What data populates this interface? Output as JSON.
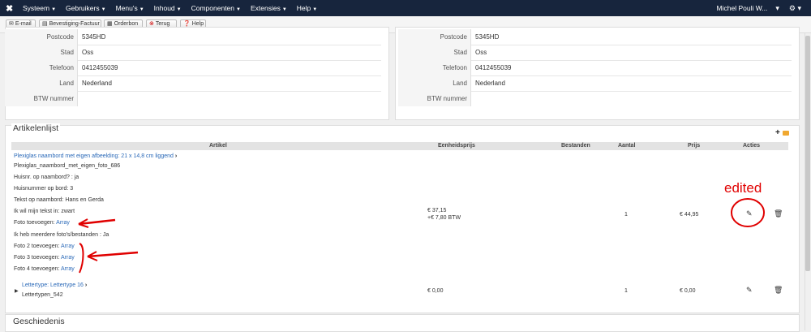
{
  "topbar": {
    "menu": [
      {
        "label": "Systeem"
      },
      {
        "label": "Gebruikers"
      },
      {
        "label": "Menu's"
      },
      {
        "label": "Inhoud"
      },
      {
        "label": "Componenten"
      },
      {
        "label": "Extensies"
      },
      {
        "label": "Help"
      }
    ],
    "user_name": "Michel Pouli W..."
  },
  "toolbar": {
    "email_label": "E-mail",
    "confirm_label": "Bevestiging-Factuur",
    "order_label": "Orderbon",
    "back_label": "Terug",
    "help_label": "Help"
  },
  "billing_address": {
    "postcode_label": "Postcode",
    "postcode": "5345HD",
    "city_label": "Stad",
    "city": "Oss",
    "phone_label": "Telefoon",
    "phone": "0412455039",
    "country_label": "Land",
    "country": "Nederland",
    "vat_label": "BTW nummer",
    "vat": ""
  },
  "shipping_address": {
    "postcode_label": "Postcode",
    "postcode": "5345HD",
    "city_label": "Stad",
    "city": "Oss",
    "phone_label": "Telefoon",
    "phone": "0412455039",
    "country_label": "Land",
    "country": "Nederland",
    "vat_label": "BTW nummer",
    "vat": ""
  },
  "articles": {
    "title": "Artikelenlijst",
    "columns": {
      "article": "Artikel",
      "unit_price": "Eenheidsprijs",
      "files": "Bestanden",
      "quantity": "Aantal",
      "price": "Prijs",
      "actions": "Acties"
    },
    "item1": {
      "name": "Plexiglas naambord met eigen afbeelding: 21 x 14,8 cm liggend",
      "sku": "Plexiglas_naambord_met_eigen_foto_686",
      "attr1": "Huisnr. op naambord? : ja",
      "attr2": "Huisnummer op bord: 3",
      "attr3": "Tekst op naambord: Hans en Gerda",
      "attr4": "Ik wil mijn tekst in: zwart",
      "attr5_label": "Foto toevoegen:",
      "attr5_value": "Array",
      "attr6": "Ik heb meerdere foto's/bestanden : Ja",
      "attr7_label": "Foto 2 toevoegen:",
      "attr7_value": "Array",
      "attr8_label": "Foto 3 toevoegen:",
      "attr8_value": "Array",
      "attr9_label": "Foto 4 toevoegen:",
      "attr9_value": "Array",
      "unit_price": "€ 37,15",
      "tax": "+€ 7,80 BTW",
      "quantity": "1",
      "price": "€ 44,95"
    },
    "item2": {
      "name": "Lettertype: Lettertype 16",
      "sku": "Lettertypen_542",
      "unit_price": "€ 0,00",
      "quantity": "1",
      "price": "€ 0,00"
    }
  },
  "annotation": {
    "text": "edited",
    "color": "#e00000"
  },
  "history": {
    "title": "Geschiedenis"
  }
}
